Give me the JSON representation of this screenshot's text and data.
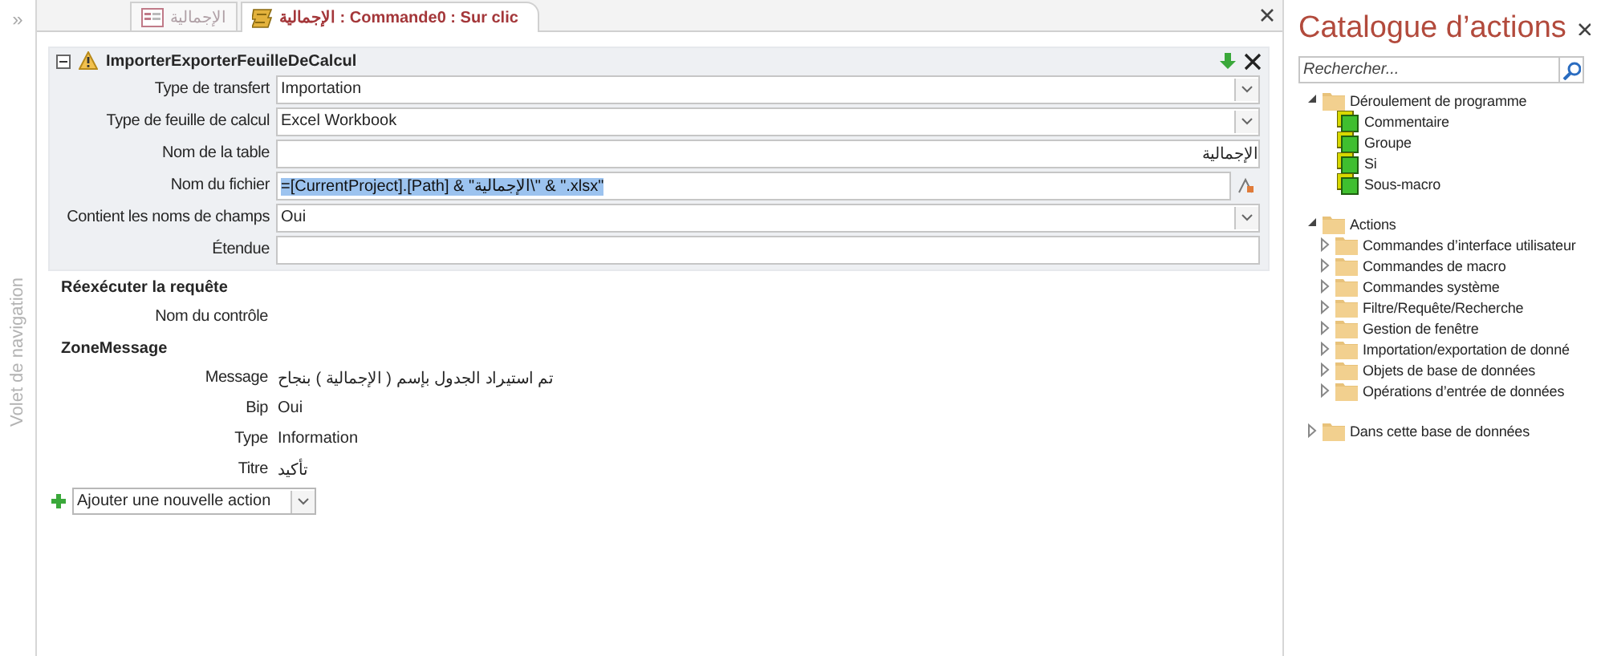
{
  "nav_pane": {
    "toggle": "»",
    "title": "Volet de navigation"
  },
  "tabs": [
    {
      "label": "الإجمالية",
      "kind": "form",
      "selected": false
    },
    {
      "label": "الإجمالية : Commande0 : Sur clic",
      "kind": "macro",
      "selected": true
    }
  ],
  "macro": {
    "actions": [
      {
        "name": "ImporterExporterFeuilleDeCalcul",
        "selected": true,
        "expanded": true,
        "warning": true,
        "arguments": [
          {
            "label": "Type de transfert",
            "value": "Importation",
            "kind": "dropdown"
          },
          {
            "label": "Type de feuille de calcul",
            "value": "Excel Workbook",
            "kind": "dropdown"
          },
          {
            "label": "Nom de la table",
            "value": "الإجمالية",
            "kind": "text"
          },
          {
            "label": "Nom du fichier",
            "value": "=[CurrentProject].[Path] & \"الإجمالية\\\" & \".xlsx\"",
            "kind": "builder",
            "highlighted": true
          },
          {
            "label": "Contient les noms de champs",
            "value": "Oui",
            "kind": "dropdown"
          },
          {
            "label": "Étendue",
            "kind": "text"
          }
        ]
      },
      {
        "name": "Réexécuter la requête",
        "selected": false,
        "arguments": [
          {
            "label": "Nom du contrôle"
          }
        ]
      },
      {
        "name": "ZoneMessage",
        "selected": false,
        "arguments": [
          {
            "label": "Message",
            "value": "تم استيراد الجدول بإسم ( الإجمالية ) بنجاح"
          },
          {
            "label": "Bip",
            "value": "Oui"
          },
          {
            "label": "Type",
            "value": "Information"
          },
          {
            "label": "Titre",
            "value": "تأكيد"
          }
        ]
      }
    ],
    "add_action": {
      "value": "Ajouter une nouvelle action"
    }
  },
  "catalog": {
    "title": "Catalogue d’actions",
    "search": {
      "placeholder": "Rechercher..."
    },
    "tree": [
      {
        "label": "Déroulement de programme",
        "expanded": true,
        "children": [
          {
            "label": "Commentaire"
          },
          {
            "label": "Groupe"
          },
          {
            "label": "Si"
          },
          {
            "label": "Sous-macro"
          }
        ]
      },
      {
        "label": "Actions",
        "expanded": true,
        "children": [
          {
            "label": "Commandes d’interface utilisateur",
            "expanded": false
          },
          {
            "label": "Commandes de macro",
            "expanded": false
          },
          {
            "label": "Commandes système",
            "expanded": false
          },
          {
            "label": "Filtre/Requête/Recherche",
            "expanded": false
          },
          {
            "label": "Gestion de fenêtre",
            "expanded": false
          },
          {
            "label": "Importation/exportation de donné",
            "expanded": false
          },
          {
            "label": "Objets de base de données",
            "expanded": false
          },
          {
            "label": "Opérations d’entrée de données",
            "expanded": false
          }
        ]
      },
      {
        "label": "Dans cette base de données",
        "expanded": false
      }
    ]
  }
}
